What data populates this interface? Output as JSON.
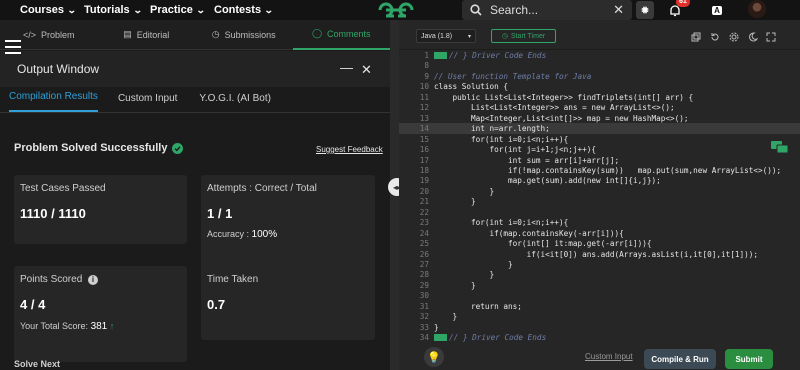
{
  "nav": {
    "items": [
      {
        "label": "Courses"
      },
      {
        "label": "Tutorials"
      },
      {
        "label": "Practice"
      },
      {
        "label": "Contests"
      }
    ],
    "search_placeholder": "Search...",
    "notification_count": "61"
  },
  "problem_tabs": [
    "Problem",
    "Editorial",
    "Submissions",
    "Comments"
  ],
  "output": {
    "title": "Output Window",
    "tabs": [
      "Compilation Results",
      "Custom Input",
      "Y.O.G.I. (AI Bot)"
    ],
    "status": "Problem Solved Successfully",
    "feedback_link": "Suggest Feedback",
    "test_cases_label": "Test Cases Passed",
    "test_cases_value": "1110 / 1110",
    "attempts_label": "Attempts : Correct / Total",
    "attempts_value": "1 / 1",
    "accuracy_label": "Accuracy :",
    "accuracy_value": "100%",
    "points_label": "Points Scored",
    "points_value": "4 / 4",
    "total_score_label": "Your Total Score:",
    "total_score_value": "381",
    "time_label": "Time Taken",
    "time_value": "0.7",
    "solve_next": "Solve Next"
  },
  "editor": {
    "language": "Java (1.8)",
    "timer_label": "Start Timer",
    "custom_input": "Custom Input",
    "compile_run": "Compile & Run",
    "submit": "Submit",
    "lines": [
      {
        "n": "1",
        "text": "// } Driver Code Ends",
        "folded": true
      },
      {
        "n": "8",
        "text": ""
      },
      {
        "n": "9",
        "text": "// User function Template for Java"
      },
      {
        "n": "10",
        "text": "class Solution {"
      },
      {
        "n": "11",
        "text": "    public List<List<Integer>> findTriplets(int[] arr) {"
      },
      {
        "n": "12",
        "text": "        List<List<Integer>> ans = new ArrayList<>();"
      },
      {
        "n": "13",
        "text": "        Map<Integer,List<int[]>> map = new HashMap<>();"
      },
      {
        "n": "14",
        "text": "        int n=arr.length;",
        "highlight": true
      },
      {
        "n": "15",
        "text": "        for(int i=0;i<n;i++){"
      },
      {
        "n": "16",
        "text": "            for(int j=i+1;j<n;j++){"
      },
      {
        "n": "17",
        "text": "                int sum = arr[i]+arr[j];"
      },
      {
        "n": "18",
        "text": "                if(!map.containsKey(sum))   map.put(sum,new ArrayList<>());"
      },
      {
        "n": "19",
        "text": "                map.get(sum).add(new int[]{i,j});"
      },
      {
        "n": "20",
        "text": "            }"
      },
      {
        "n": "21",
        "text": "        }"
      },
      {
        "n": "22",
        "text": ""
      },
      {
        "n": "23",
        "text": "        for(int i=0;i<n;i++){"
      },
      {
        "n": "24",
        "text": "            if(map.containsKey(-arr[i])){"
      },
      {
        "n": "25",
        "text": "                for(int[] it:map.get(-arr[i])){"
      },
      {
        "n": "26",
        "text": "                    if(i<it[0]) ans.add(Arrays.asList(i,it[0],it[1]));"
      },
      {
        "n": "27",
        "text": "                }"
      },
      {
        "n": "28",
        "text": "            }"
      },
      {
        "n": "29",
        "text": "        }"
      },
      {
        "n": "30",
        "text": ""
      },
      {
        "n": "31",
        "text": "        return ans;"
      },
      {
        "n": "32",
        "text": "    }"
      },
      {
        "n": "33",
        "text": "}"
      },
      {
        "n": "34",
        "text": "// } Driver Code Ends",
        "folded": true
      }
    ]
  },
  "colors": {
    "accent_green": "#2fa568",
    "tab_blue": "#2fa0d8",
    "submit_green": "#2a8d3f",
    "badge_red": "#e0312b"
  }
}
